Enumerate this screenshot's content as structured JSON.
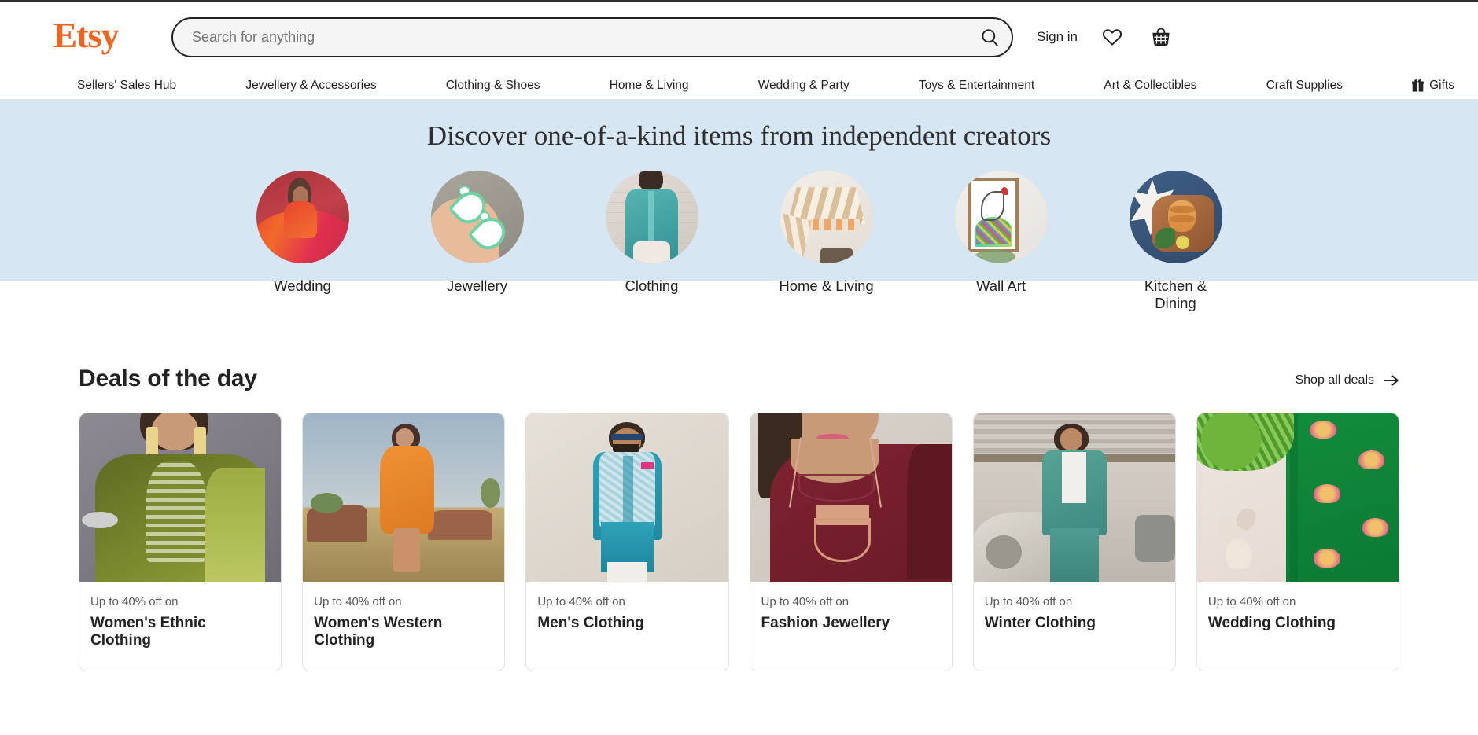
{
  "brand": {
    "logo_text": "Etsy",
    "logo_color": "#f1641e"
  },
  "search": {
    "placeholder": "Search for anything",
    "value": "",
    "icon": "search-icon"
  },
  "header_right": {
    "sign_in_label": "Sign in",
    "favorites_icon": "heart-icon",
    "cart_icon": "basket-icon"
  },
  "nav": {
    "items": [
      {
        "label": "Sellers' Sales Hub"
      },
      {
        "label": "Jewellery & Accessories"
      },
      {
        "label": "Clothing & Shoes"
      },
      {
        "label": "Home & Living"
      },
      {
        "label": "Wedding & Party"
      },
      {
        "label": "Toys & Entertainment"
      },
      {
        "label": "Art & Collectibles"
      },
      {
        "label": "Craft Supplies"
      }
    ],
    "gifts": {
      "label": "Gifts",
      "icon": "gift-icon"
    }
  },
  "hero": {
    "title": "Discover one-of-a-kind items from independent creators",
    "background_color": "#d7e6f3",
    "categories": [
      {
        "label": "Wedding",
        "image": "woman-in-red-saree"
      },
      {
        "label": "Jewellery",
        "image": "hand-holding-green-heart-earrings"
      },
      {
        "label": "Clothing",
        "image": "woman-in-teal-shirt"
      },
      {
        "label": "Home & Living",
        "image": "paper-pendant-lamp"
      },
      {
        "label": "Wall Art",
        "image": "framed-swan-print"
      },
      {
        "label": "Kitchen & Dining",
        "image": "marble-wood-serving-board"
      }
    ]
  },
  "deals": {
    "title": "Deals of the day",
    "shop_all_label": "Shop all deals",
    "shop_all_icon": "arrow-right-icon",
    "cards": [
      {
        "sub": "Up to 40% off on",
        "name": "Women's Ethnic Clothing",
        "image": "woman-in-olive-kurta"
      },
      {
        "sub": "Up to 40% off on",
        "name": "Women's Western Clothing",
        "image": "woman-in-orange-dress-desert"
      },
      {
        "sub": "Up to 40% off on",
        "name": "Men's Clothing",
        "image": "man-in-teal-kurta-nehru-jacket"
      },
      {
        "sub": "Up to 40% off on",
        "name": "Fashion Jewellery",
        "image": "woman-wearing-geometric-pendant"
      },
      {
        "sub": "Up to 40% off on",
        "name": "Winter Clothing",
        "image": "woman-in-teal-coord-set"
      },
      {
        "sub": "Up to 40% off on",
        "name": "Wedding Clothing",
        "image": "green-brocade-fabric-with-shells"
      }
    ]
  }
}
